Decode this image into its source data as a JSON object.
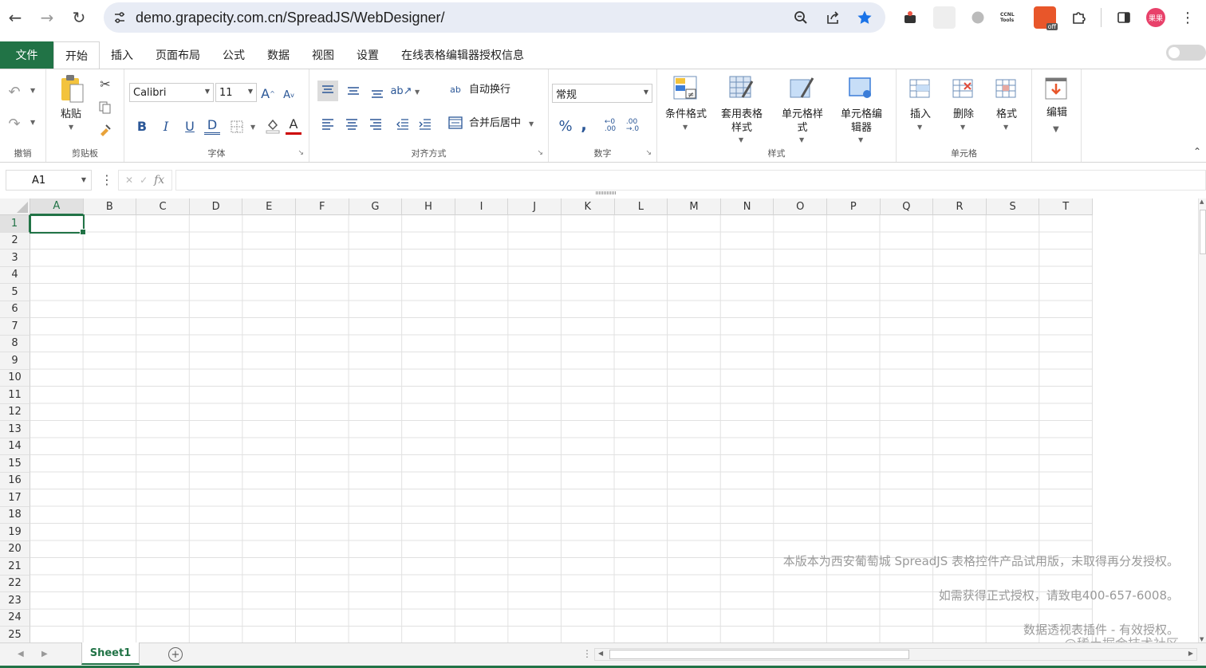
{
  "browser": {
    "url": "demo.grapecity.com.cn/SpreadJS/WebDesigner/",
    "ext_labels": [
      "CCNL Tools",
      "off"
    ],
    "profile_label": "果果"
  },
  "ribbon_tabs": [
    "文件",
    "开始",
    "插入",
    "页面布局",
    "公式",
    "数据",
    "视图",
    "设置",
    "在线表格编辑器授权信息"
  ],
  "ribbon": {
    "undo_group": "撤销",
    "clipboard": {
      "label": "剪贴板",
      "paste": "粘贴"
    },
    "font": {
      "label": "字体",
      "family": "Calibri",
      "size": "11"
    },
    "alignment": {
      "label": "对齐方式",
      "wrap": "自动换行",
      "merge": "合并后居中"
    },
    "number": {
      "label": "数字",
      "format": "常规"
    },
    "styles": {
      "label": "样式",
      "conditional": "条件格式",
      "table_style": "套用表格样式",
      "cell_style": "单元格样式",
      "cell_editor": "单元格编辑器"
    },
    "cells": {
      "label": "单元格",
      "insert": "插入",
      "delete": "删除",
      "format": "格式"
    },
    "edit": {
      "label": "编辑"
    }
  },
  "formula_bar": {
    "name_box": "A1",
    "fx": "fx"
  },
  "columns": [
    "A",
    "B",
    "C",
    "D",
    "E",
    "F",
    "G",
    "H",
    "I",
    "J",
    "K",
    "L",
    "M",
    "N",
    "O",
    "P",
    "Q",
    "R",
    "S",
    "T"
  ],
  "rows": [
    "1",
    "2",
    "3",
    "4",
    "5",
    "6",
    "7",
    "8",
    "9",
    "10",
    "11",
    "12",
    "13",
    "14",
    "15",
    "16",
    "17",
    "18",
    "19",
    "20",
    "21",
    "22",
    "23",
    "24",
    "25"
  ],
  "selected_cell": "A1",
  "watermark": [
    "本版本为西安葡萄城 SpreadJS 表格控件产品试用版，未取得再分发授权。",
    "如需获得正式授权，请致电400-657-6008。",
    "数据透视表插件 - 有效授权。",
    "@稀土掘金技术社区"
  ],
  "sheets": [
    "Sheet1"
  ],
  "colors": {
    "accent": "#217346",
    "star": "#1a73e8"
  }
}
